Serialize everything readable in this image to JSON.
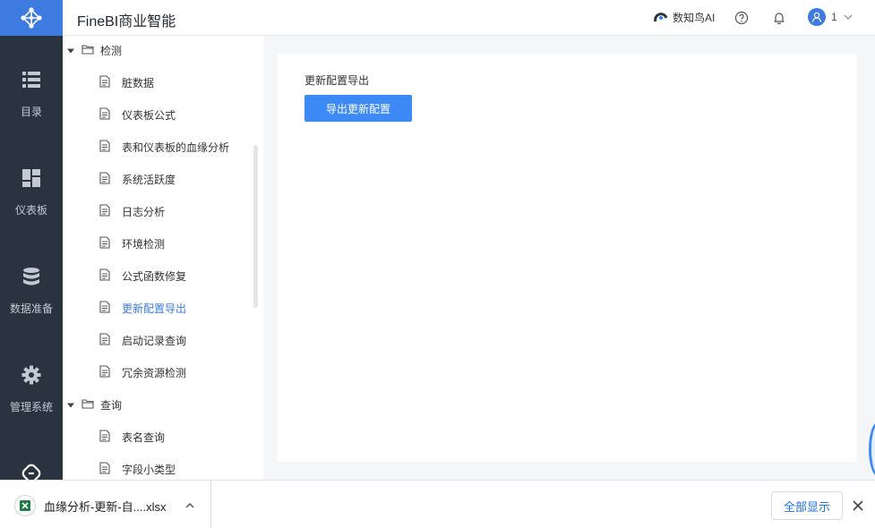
{
  "header": {
    "app_title": "FineBI商业智能",
    "ai_label": "数知鸟AI",
    "user_name": "1"
  },
  "nav": {
    "items": [
      {
        "label": "目录",
        "icon": "list-icon"
      },
      {
        "label": "仪表板",
        "icon": "dashboard-icon"
      },
      {
        "label": "数据准备",
        "icon": "database-icon"
      },
      {
        "label": "管理系统",
        "icon": "gear-icon"
      },
      {
        "label": "",
        "icon": "plugin-icon"
      }
    ]
  },
  "tree": {
    "groups": [
      {
        "label": "检测",
        "items": [
          "脏数据",
          "仪表板公式",
          "表和仪表板的血缘分析",
          "系统活跃度",
          "日志分析",
          "环境检测",
          "公式函数修复",
          "更新配置导出",
          "启动记录查询",
          "冗余资源检测"
        ]
      },
      {
        "label": "查询",
        "items": [
          "表名查询",
          "字段小类型"
        ]
      }
    ],
    "active_item": "更新配置导出"
  },
  "content": {
    "title": "更新配置导出",
    "button_label": "导出更新配置"
  },
  "download_bar": {
    "file_name": "血缘分析-更新-自....xlsx",
    "show_all_label": "全部显示"
  },
  "colors": {
    "accent": "#3d7be0",
    "button": "#3d8af7",
    "nav_bg": "#2a3340",
    "canvas_bg": "#f5f6f8"
  }
}
